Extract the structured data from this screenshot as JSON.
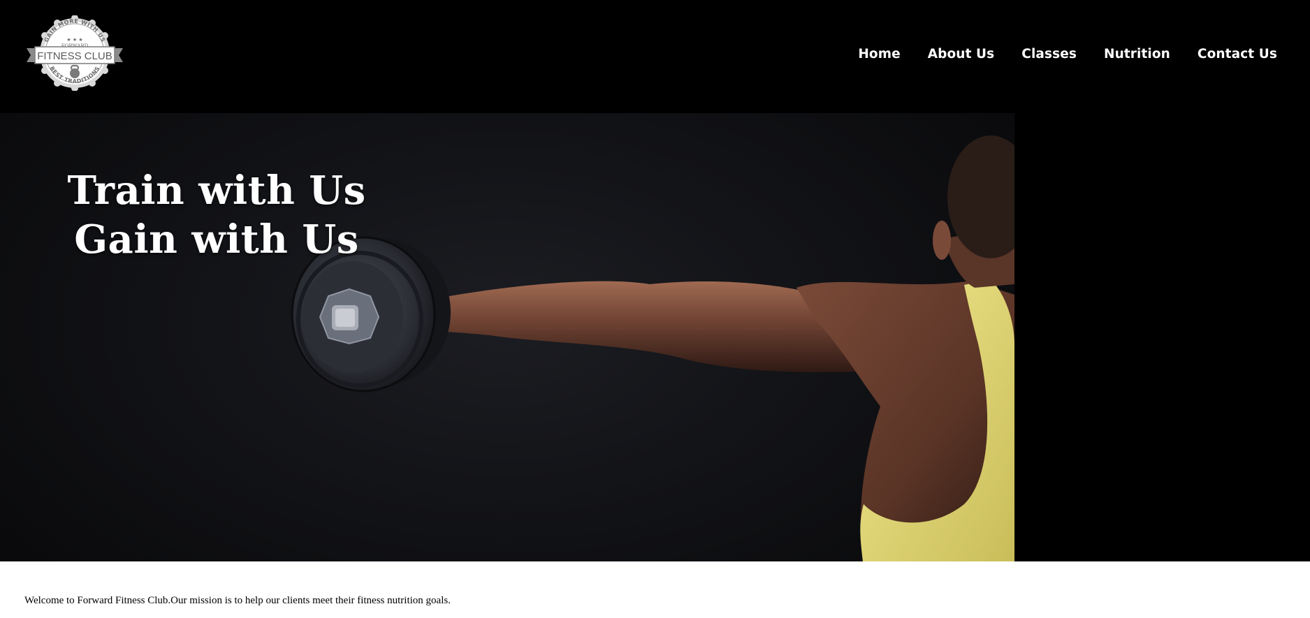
{
  "logo": {
    "arc_top": "GAIN MORE WITH US",
    "brand_small": "FORWARD",
    "brand_main": "FITNESS CLUB",
    "arc_bottom": "BEST TRADITIONS"
  },
  "nav": {
    "items": [
      {
        "label": "Home"
      },
      {
        "label": "About Us"
      },
      {
        "label": "Classes"
      },
      {
        "label": "Nutrition"
      },
      {
        "label": "Contact Us"
      }
    ]
  },
  "hero": {
    "line1": "Train with Us",
    "line2": "Gain with Us",
    "image": "athlete-lifting-dumbbell-photo"
  },
  "main": {
    "welcome_text": "Welcome to Forward Fitness Club.Our mission is to help our clients meet their fitness nutrition goals."
  },
  "colors": {
    "header_bg": "#000000",
    "nav_text": "#ffffff",
    "hero_text": "#ffffff",
    "tank_top": "#e6dc78"
  }
}
